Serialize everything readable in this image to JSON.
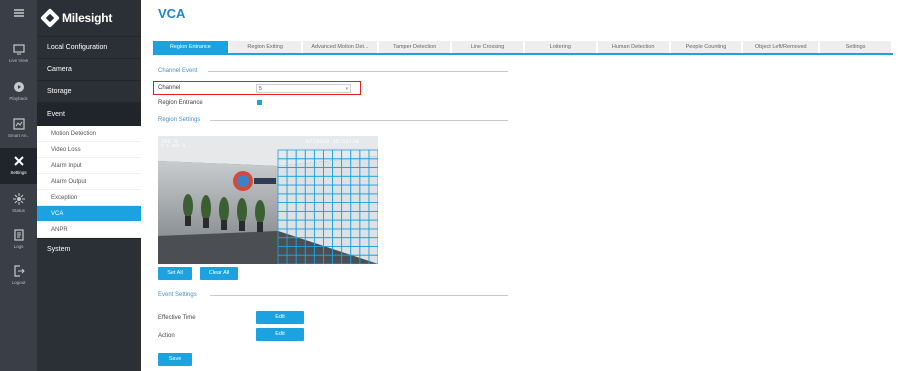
{
  "rail": [
    {
      "icon": "live-view-icon",
      "label": "Live View"
    },
    {
      "icon": "playback-icon",
      "label": "Playback"
    },
    {
      "icon": "smart-analysis-icon",
      "label": "Smart An.."
    },
    {
      "icon": "settings-icon",
      "label": "Settings"
    },
    {
      "icon": "status-icon",
      "label": "Status"
    },
    {
      "icon": "logs-icon",
      "label": "Logs"
    },
    {
      "icon": "logout-icon",
      "label": "Logout"
    }
  ],
  "brand": "Milesight",
  "menu": {
    "local_config": "Local Configuration",
    "camera": "Camera",
    "storage": "Storage",
    "event": "Event",
    "event_items": [
      "Motion Detection",
      "Video Loss",
      "Alarm Input",
      "Alarm Output",
      "Exception",
      "VCA",
      "ANPR"
    ],
    "system": "System"
  },
  "page_title": "VCA",
  "tabs": [
    "Region Entrance",
    "Region Exiting",
    "Advanced Motion Det...",
    "Tamper Detection",
    "Line Crossing",
    "Loitering",
    "Human Detection",
    "People Counting",
    "Object Left/Removed",
    "Settings"
  ],
  "channel_event": {
    "heading": "Channel Event",
    "channel_label": "Channel",
    "channel_value": "5",
    "region_entrance_label": "Region Entrance",
    "region_entrance_checked": true
  },
  "region_settings": {
    "heading": "Region Settings",
    "osd_left": "IPC 5\nC 1 Sat 0..",
    "osd_time": "07/2020 15:13:28",
    "set_all": "Set All",
    "clear_all": "Clear All"
  },
  "event_settings": {
    "heading": "Event Settings",
    "effective_time_label": "Effective Time",
    "action_label": "Action",
    "edit": "Edit",
    "save": "Save"
  },
  "colors": {
    "accent": "#1aa3e0",
    "highlight": "#e02020",
    "menu_bg": "#2b3036",
    "rail_bg": "#3a3f47"
  }
}
